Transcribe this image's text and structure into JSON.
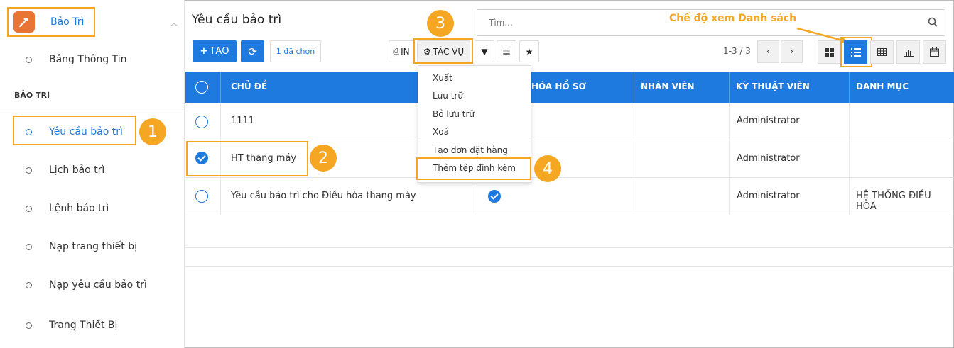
{
  "sidebar": {
    "app_name": "Bảo Trì",
    "items": [
      {
        "label": "Bảng Thông Tin"
      },
      {
        "label": "Yêu cầu bảo trì"
      },
      {
        "label": "Lịch bảo trì"
      },
      {
        "label": "Lệnh bảo trì"
      },
      {
        "label": "Nạp trang thiết bị"
      },
      {
        "label": "Nạp yêu cầu bảo trì"
      },
      {
        "label": "Trang Thiết Bị"
      }
    ],
    "section_label": "BẢO TRÌ"
  },
  "header": {
    "title": "Yêu cầu bảo trì",
    "search_placeholder": "Tìm..."
  },
  "toolbar": {
    "create_label": "TẠO",
    "selected_label": "1 đã chọn",
    "print_label": "IN",
    "action_label": "TÁC VỤ",
    "pager": "1-3 / 3"
  },
  "annotation": {
    "view_hint": "Chế độ xem Danh sách",
    "callouts": [
      "1",
      "2",
      "3",
      "4"
    ]
  },
  "table": {
    "headers": [
      "CHỦ ĐỀ",
      "HÓA HỒ SƠ",
      "NHÂN VIÊN",
      "KỸ THUẬT VIÊN",
      "DANH MỤC"
    ],
    "rows": [
      {
        "subject": "1111",
        "technician": "Administrator",
        "category": "",
        "checked": false,
        "archived": false
      },
      {
        "subject": "HT thang máy",
        "technician": "Administrator",
        "category": "",
        "checked": true,
        "archived": false
      },
      {
        "subject": "Yêu cầu bảo trì cho Điều hòa thang máy",
        "technician": "Administrator",
        "category": "HỆ THỐNG ĐIỀU HÒA",
        "checked": false,
        "archived": true
      }
    ]
  },
  "action_menu": {
    "items": [
      "Xuất",
      "Lưu trữ",
      "Bỏ lưu trữ",
      "Xoá",
      "Tạo đơn đặt hàng",
      "Thêm tệp đính kèm"
    ]
  },
  "colors": {
    "primary": "#1f7adf",
    "highlight": "#f5a623",
    "logo": "#ea7433"
  }
}
